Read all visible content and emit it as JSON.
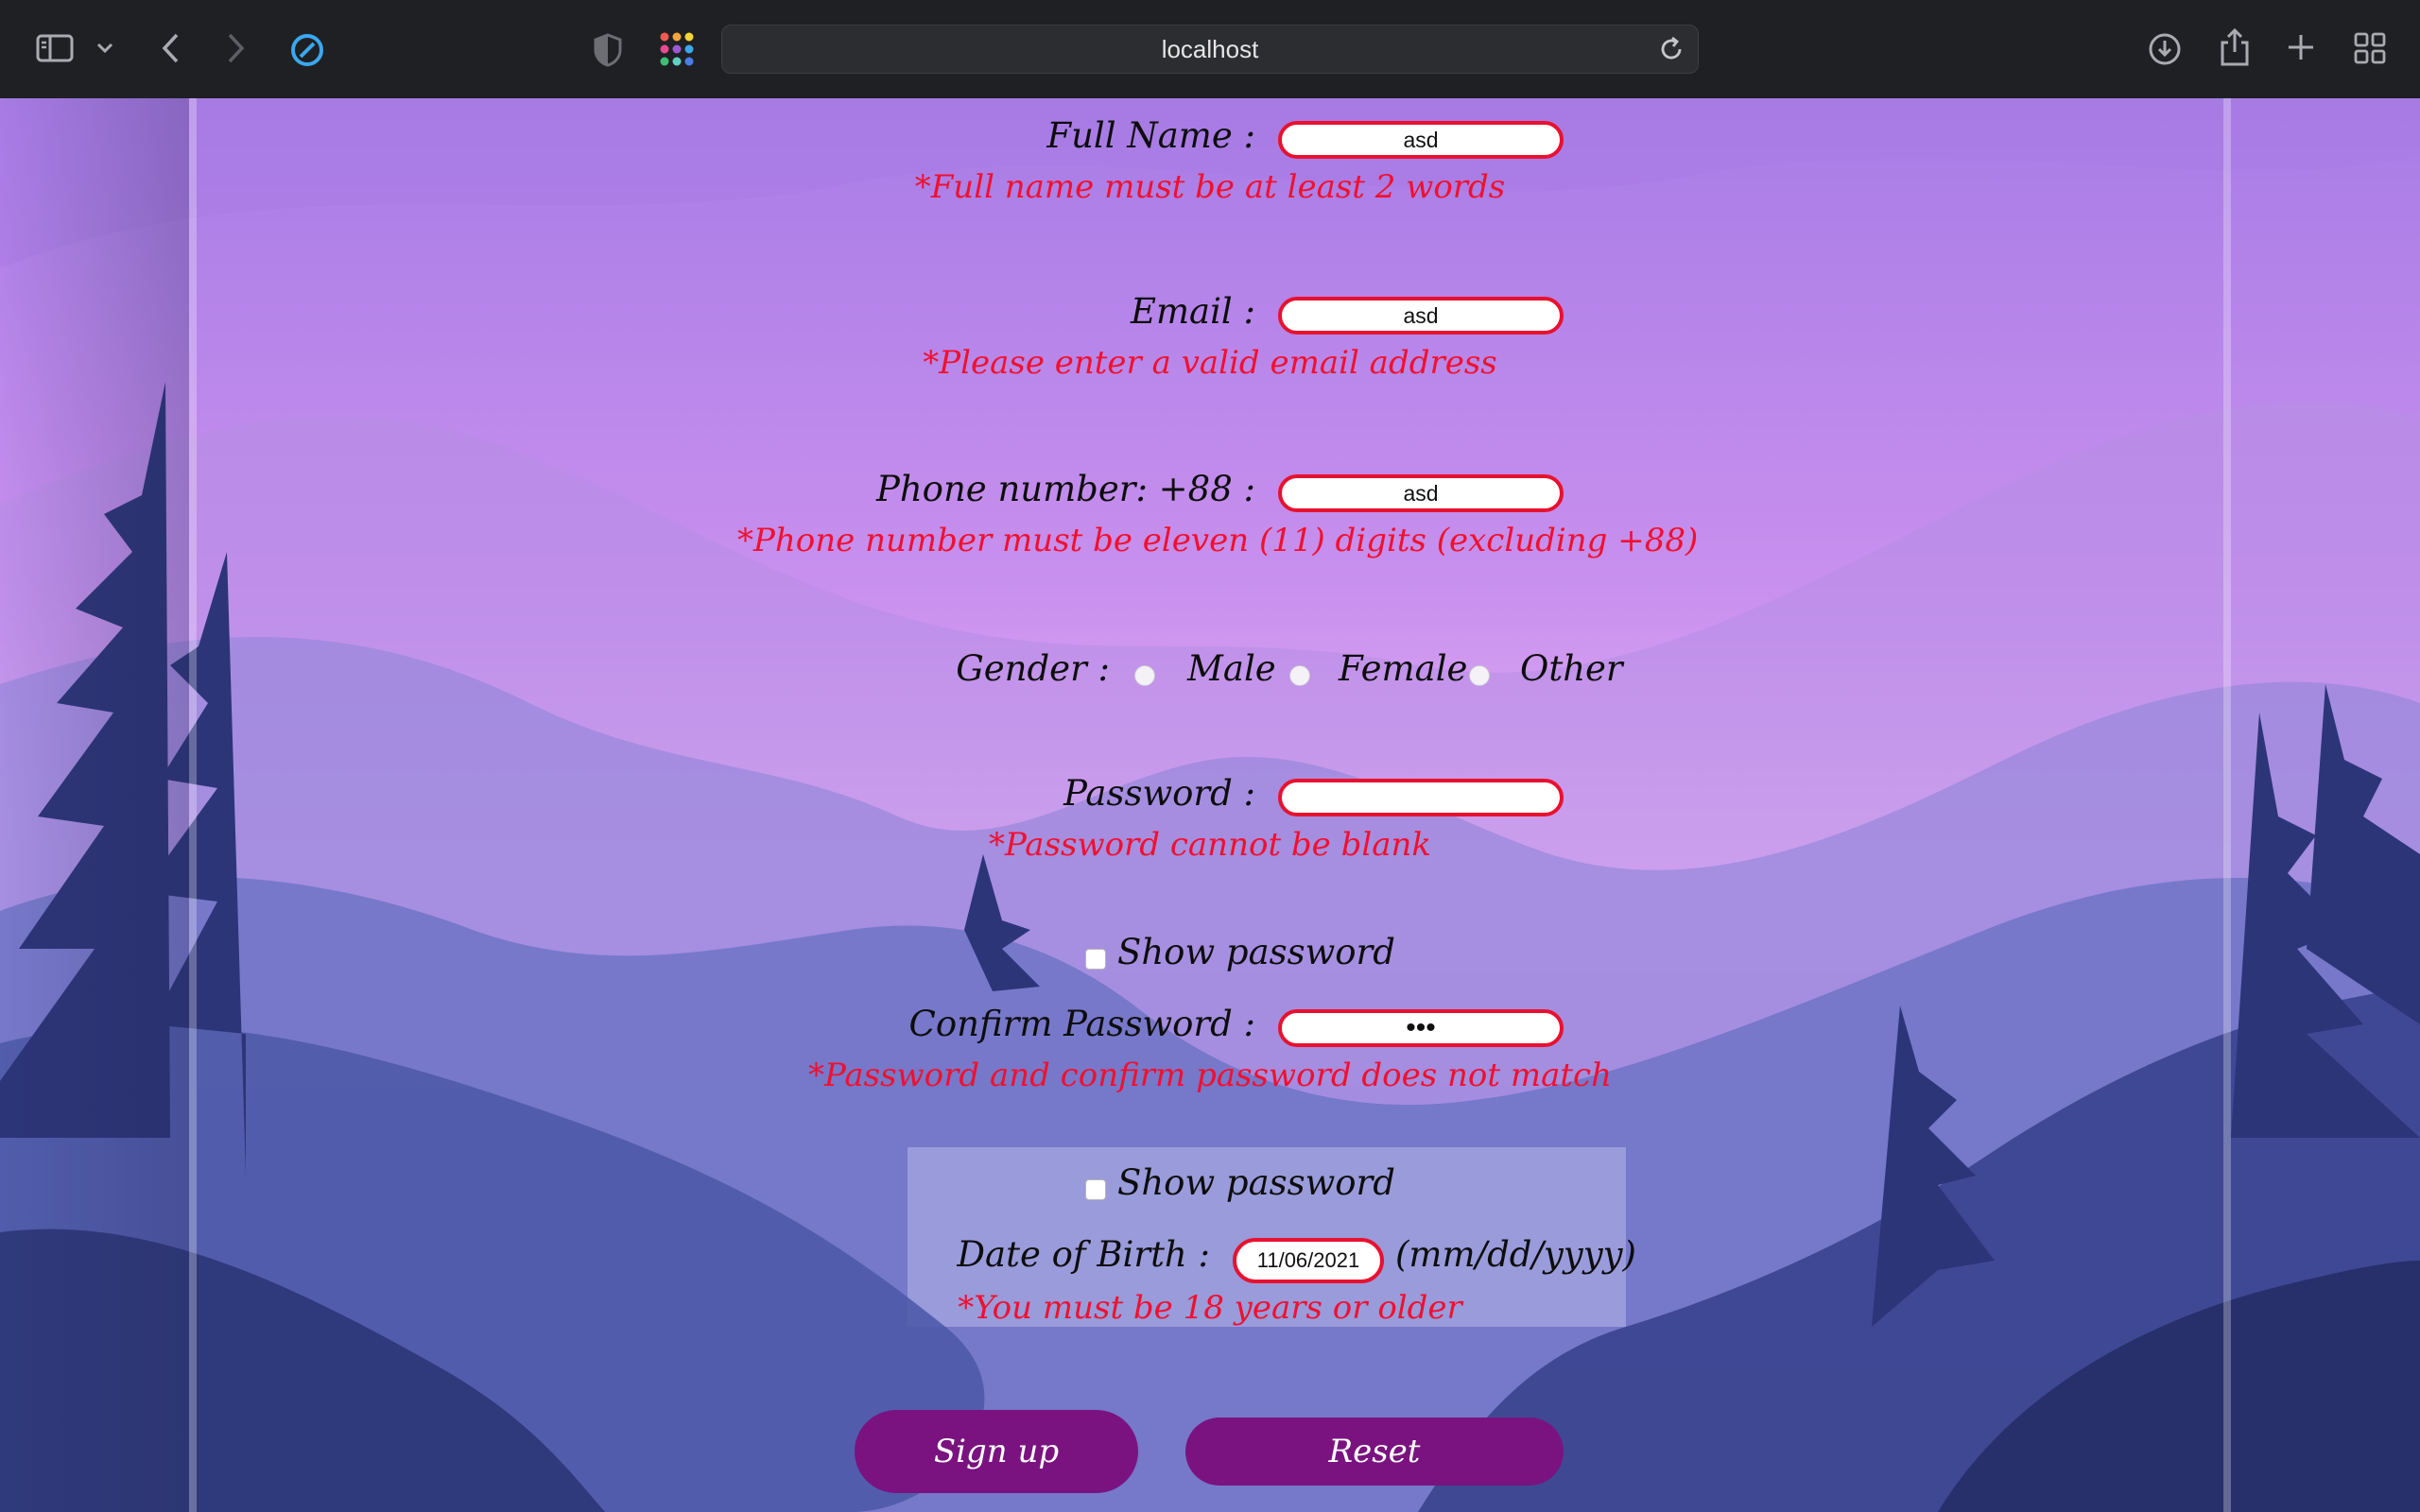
{
  "browser": {
    "url": "localhost",
    "icons": {
      "sidebar": "sidebar-icon",
      "sidebar_menu": "chevron-down-icon",
      "back": "chevron-left-icon",
      "forward": "chevron-right-icon",
      "privacy": "compass-icon",
      "shield": "shield-icon",
      "extensions": "grid-dots-icon",
      "reload": "reload-icon",
      "downloads": "download-icon",
      "share": "share-icon",
      "new_tab": "plus-icon",
      "tab_overview": "tabs-grid-icon"
    }
  },
  "form": {
    "full_name": {
      "label": "Full Name :",
      "value": "asd",
      "error": "*Full name must be at least 2 words"
    },
    "email": {
      "label": "Email :",
      "value": "asd",
      "error": "*Please enter a valid email address"
    },
    "phone": {
      "label": "Phone number: +88 :",
      "value": "asd",
      "error": "*Phone number must be eleven (11) digits (excluding +88)"
    },
    "gender": {
      "label": "Gender :",
      "options": [
        "Male",
        "Female",
        "Other"
      ]
    },
    "password": {
      "label": "Password :",
      "value": "",
      "error": "*Password cannot be blank",
      "show_label": "Show password"
    },
    "confirm_password": {
      "label": "Confirm Password :",
      "value": "•••",
      "error": "*Password and confirm password does not match",
      "show_label": "Show password"
    },
    "dob": {
      "label": "Date of Birth :",
      "value": "11/06/2021",
      "format_hint": "(mm/dd/yyyy)",
      "error": "*You must be 18 years or older"
    },
    "buttons": {
      "signup": "Sign up",
      "reset": "Reset"
    }
  },
  "colors": {
    "error": "#f0102f",
    "field_border": "#e8112f",
    "button": "#7a1380",
    "chrome": "#1f2023"
  }
}
